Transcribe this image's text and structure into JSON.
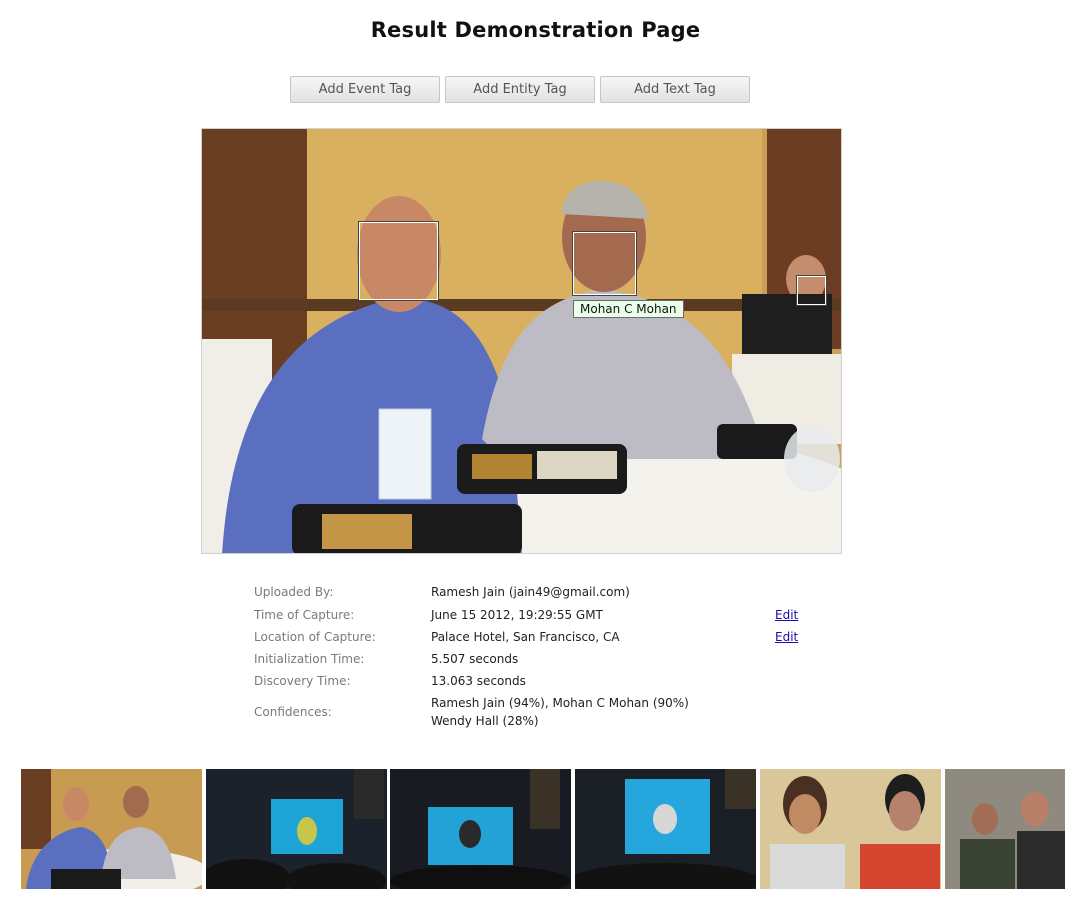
{
  "page": {
    "title": "Result Demonstration Page"
  },
  "toolbar": {
    "add_event_tag": "Add Event Tag",
    "add_entity_tag": "Add Entity Tag",
    "add_text_tag": "Add Text Tag"
  },
  "photo": {
    "face_label": "Mohan C Mohan"
  },
  "metadata": {
    "uploaded_by": {
      "label": "Uploaded By:",
      "value": "Ramesh Jain (jain49@gmail.com)"
    },
    "time_of_capture": {
      "label": "Time of Capture:",
      "value": "June 15 2012, 19:29:55 GMT",
      "edit": "Edit"
    },
    "location_of_capture": {
      "label": "Location of Capture:",
      "value": "Palace Hotel, San Francisco, CA",
      "edit": "Edit"
    },
    "initialization_time": {
      "label": "Initialization Time:",
      "value": "5.507 seconds"
    },
    "discovery_time": {
      "label": "Discovery Time:",
      "value": "13.063 seconds"
    },
    "confidences": {
      "label": "Confidences:",
      "line1": "Ramesh Jain (94%), Mohan C Mohan (90%)",
      "line2": "Wendy Hall (28%)"
    }
  },
  "colors": {
    "label_gray": "#7a7a7a",
    "link_blue": "#1a0dab",
    "face_label_bg": "#eaffea"
  }
}
